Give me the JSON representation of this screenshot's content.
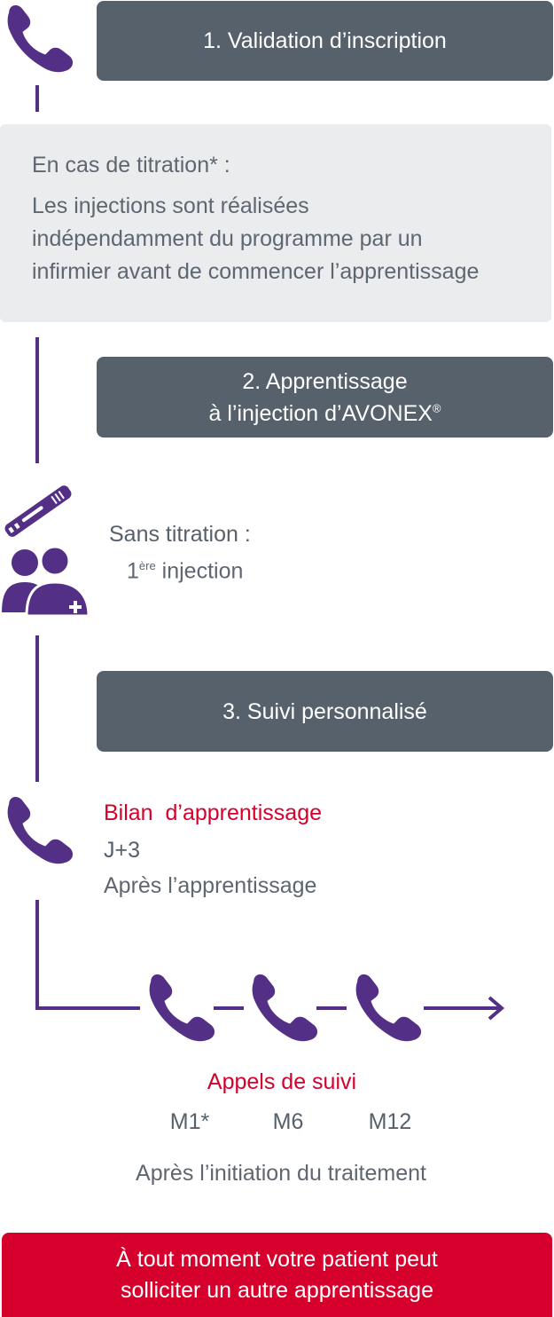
{
  "steps": {
    "step1": "1. Validation d’inscription",
    "step2_line1": "2. Apprentissage",
    "step2_line2": "à l’injection d’AVONEX",
    "step2_reg": "®",
    "step3": "3. Suivi personnalisé"
  },
  "titration": {
    "title": "En cas de titration* :",
    "line1": "Les injections sont réalisées",
    "line2": "indépendamment du programme par un",
    "line3": "infirmier avant de commencer l’apprentissage"
  },
  "no_titration": {
    "title": "Sans titration :",
    "ordinal": "1",
    "ordinal_suffix": "ère",
    "injection": " injection"
  },
  "bilan": {
    "title": "Bilan  d’apprentissage",
    "day": "J+3",
    "after": "Après l’apprentissage"
  },
  "follow_up": {
    "title": "Appels de suivi",
    "months": [
      "M1*",
      "M6",
      "M12"
    ],
    "after": "Après l’initiation du traitement"
  },
  "cta": {
    "line1": "À tout moment votre patient peut",
    "line2": "solliciter un autre apprentissage"
  },
  "colors": {
    "purple": "#533086",
    "slate": "#56616b",
    "red": "#d6002c",
    "light_gray": "#ebecee"
  },
  "icons": [
    "phone-icon",
    "pen-injector-icon",
    "patient-nurse-icon",
    "arrow-right-icon"
  ]
}
